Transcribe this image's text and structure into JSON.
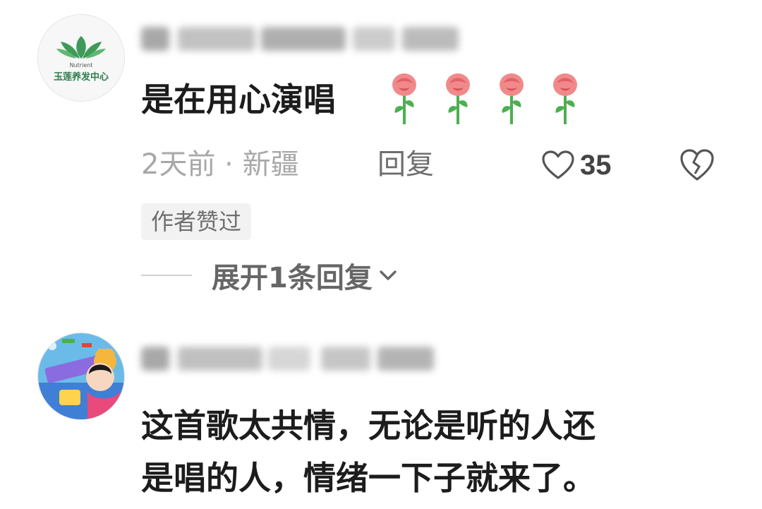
{
  "comments": [
    {
      "text": "是在用心演唱",
      "emoji": [
        "rose",
        "rose",
        "rose",
        "rose"
      ],
      "avatar_icon": "lotus-logo",
      "avatar_text_small": "Nutrient",
      "avatar_text": "玉莲养发中心",
      "username_blurred": true,
      "meta": "2天前 · 新疆",
      "reply_label": "回复",
      "like_count": "35",
      "author_badge": "作者赞过",
      "expand_label": "展开1条回复"
    },
    {
      "text_line1": "这首歌太共情，无论是听的人还",
      "text_line2": "是唱的人，情绪一下子就来了。",
      "avatar_icon": "cartoon-avatar",
      "username_blurred": true
    }
  ],
  "colors": {
    "primary_text": "#1c1c1c",
    "meta_text": "#a8a8a8",
    "reply_text": "#6e6e6e",
    "badge_bg": "#f2f2f2",
    "rose_pink": "#f08a8a",
    "leaf_green": "#4caf50",
    "avatar_green": "#2e8b57"
  },
  "icons": {
    "like": "heart-outline-icon",
    "dislike": "broken-heart-icon",
    "expand": "chevron-down-icon"
  }
}
